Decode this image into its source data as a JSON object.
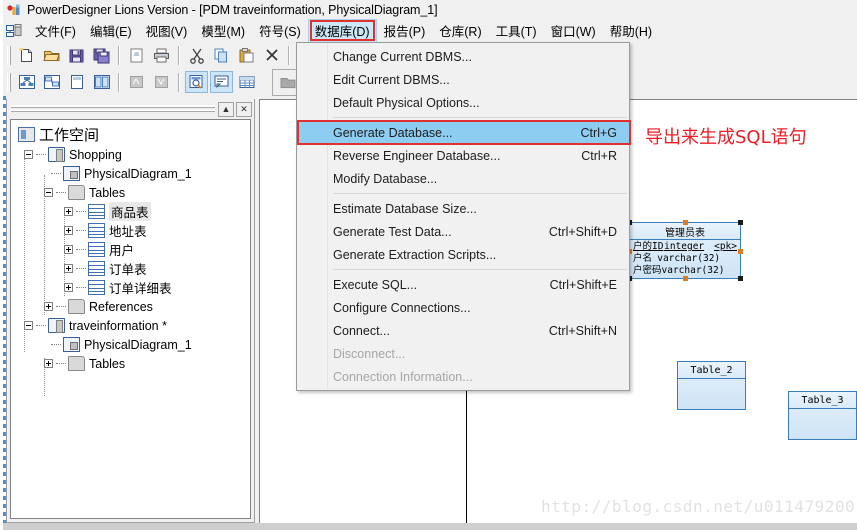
{
  "window": {
    "title": "PowerDesigner Lions Version - [PDM traveinformation, PhysicalDiagram_1]",
    "app_icon": "powerdesigner-icon"
  },
  "menubar": {
    "icon": "model-icon",
    "items": [
      {
        "label": "文件(F)",
        "name": "menu-file",
        "open": false
      },
      {
        "label": "编辑(E)",
        "name": "menu-edit",
        "open": false
      },
      {
        "label": "视图(V)",
        "name": "menu-view",
        "open": false
      },
      {
        "label": "模型(M)",
        "name": "menu-model",
        "open": false
      },
      {
        "label": "符号(S)",
        "name": "menu-symbol",
        "open": false
      },
      {
        "label": "数据库(D)",
        "name": "menu-database",
        "open": true
      },
      {
        "label": "报告(P)",
        "name": "menu-report",
        "open": false
      },
      {
        "label": "仓库(R)",
        "name": "menu-repository",
        "open": false
      },
      {
        "label": "工具(T)",
        "name": "menu-tools",
        "open": false
      },
      {
        "label": "窗口(W)",
        "name": "menu-window",
        "open": false
      },
      {
        "label": "帮助(H)",
        "name": "menu-help",
        "open": false
      }
    ]
  },
  "dropdown": {
    "owner": "数据库(D)",
    "items": [
      {
        "label": "Change Current DBMS...",
        "shortcut": "",
        "state": "normal"
      },
      {
        "label": "Edit Current DBMS...",
        "shortcut": "",
        "state": "normal"
      },
      {
        "label": "Default Physical Options...",
        "shortcut": "",
        "state": "normal"
      },
      {
        "separator": true
      },
      {
        "label": "Generate Database...",
        "shortcut": "Ctrl+G",
        "state": "highlighted"
      },
      {
        "label": "Reverse Engineer Database...",
        "shortcut": "Ctrl+R",
        "state": "normal"
      },
      {
        "label": "Modify Database...",
        "shortcut": "",
        "state": "normal"
      },
      {
        "separator": true
      },
      {
        "label": "Estimate Database Size...",
        "shortcut": "",
        "state": "normal"
      },
      {
        "label": "Generate Test Data...",
        "shortcut": "Ctrl+Shift+D",
        "state": "normal"
      },
      {
        "label": "Generate Extraction Scripts...",
        "shortcut": "",
        "state": "normal"
      },
      {
        "separator": true
      },
      {
        "label": "Execute SQL...",
        "shortcut": "Ctrl+Shift+E",
        "state": "normal"
      },
      {
        "label": "Configure Connections...",
        "shortcut": "",
        "state": "normal"
      },
      {
        "label": "Connect...",
        "shortcut": "Ctrl+Shift+N",
        "state": "normal"
      },
      {
        "label": "Disconnect...",
        "shortcut": "",
        "state": "disabled"
      },
      {
        "label": "Connection Information...",
        "shortcut": "",
        "state": "disabled"
      }
    ]
  },
  "toolbar_row1": [
    "new-icon",
    "open-icon",
    "save-icon",
    "save-all-icon",
    "print-preview-icon",
    "print-icon",
    "cut-icon",
    "copy-icon",
    "paste-icon",
    "delete-icon",
    "undo-icon",
    "redo-icon"
  ],
  "toolbar_row2": [
    "cdm-icon",
    "pdm-icon",
    "new-page-icon",
    "side-by-side-icon",
    "zoom-out-disabled-icon",
    "zoom-in-disabled-icon",
    "preview-icon",
    "comment-icon",
    "grid-icon",
    "folder-icon",
    "prev-diagram-icon",
    "next-diagram-icon"
  ],
  "tree_panel": {
    "collapse_button": "collapse-icon",
    "close_button": "close-icon",
    "nodes": [
      {
        "label": "工作空间",
        "icon": "workspace-icon",
        "indent": 0,
        "expander": "none",
        "selected": false,
        "big": true
      },
      {
        "label": "Shopping",
        "icon": "model-icon",
        "indent": 1,
        "expander": "minus",
        "selected": false
      },
      {
        "label": "PhysicalDiagram_1",
        "icon": "diagram-icon",
        "indent": 2,
        "expander": "none",
        "selected": false
      },
      {
        "label": "Tables",
        "icon": "folder-icon",
        "indent": 2,
        "expander": "minus",
        "selected": false
      },
      {
        "label": "商品表",
        "icon": "table-icon",
        "indent": 3,
        "expander": "plus",
        "selected": true
      },
      {
        "label": "地址表",
        "icon": "table-icon",
        "indent": 3,
        "expander": "plus",
        "selected": false
      },
      {
        "label": "用户",
        "icon": "table-icon",
        "indent": 3,
        "expander": "plus",
        "selected": false
      },
      {
        "label": "订单表",
        "icon": "table-icon",
        "indent": 3,
        "expander": "plus",
        "selected": false
      },
      {
        "label": "订单详细表",
        "icon": "table-icon",
        "indent": 3,
        "expander": "plus",
        "selected": false
      },
      {
        "label": "References",
        "icon": "folder-icon",
        "indent": 2,
        "expander": "plus",
        "selected": false
      },
      {
        "label": "traveinformation *",
        "icon": "model-icon",
        "indent": 1,
        "expander": "minus",
        "selected": false
      },
      {
        "label": "PhysicalDiagram_1",
        "icon": "diagram-icon",
        "indent": 2,
        "expander": "none",
        "selected": false
      },
      {
        "label": "Tables",
        "icon": "folder-icon",
        "indent": 2,
        "expander": "plus",
        "selected": false
      }
    ]
  },
  "canvas": {
    "annotation": "导出来生成SQL语句",
    "annotation_color": "#ee1c25",
    "watermark": "http://blog.csdn.net/u011479200",
    "tables": [
      {
        "name": "管理员表",
        "selected": true,
        "columns": [
          {
            "name": "户的ID",
            "type": "integer",
            "key": "<pk>"
          },
          {
            "name": "户名",
            "type": "varchar(32)",
            "key": ""
          },
          {
            "name": "户密码",
            "type": "varchar(32)",
            "key": ""
          }
        ]
      },
      {
        "name": "Table_2",
        "selected": false,
        "columns": []
      },
      {
        "name": "Table_3",
        "selected": false,
        "columns": []
      }
    ]
  }
}
